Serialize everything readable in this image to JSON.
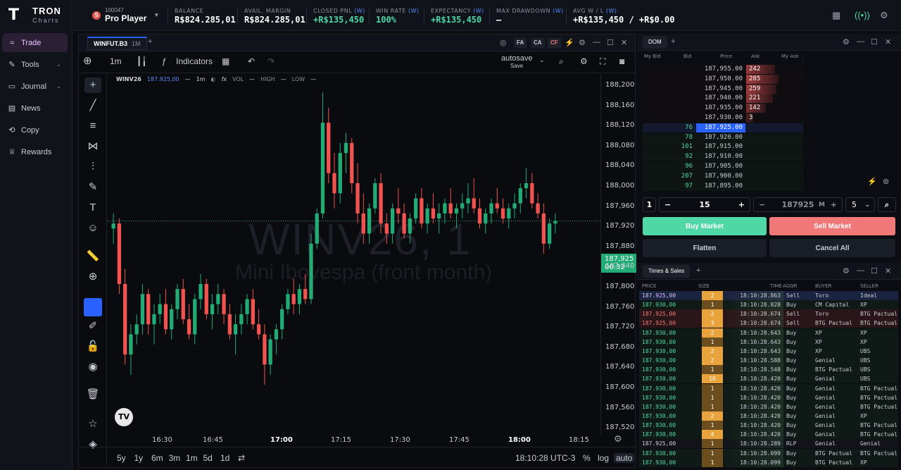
{
  "brand": {
    "name": "TRON",
    "sub": "Charts"
  },
  "nav": [
    {
      "label": "Trade",
      "icon": "chart-icon",
      "active": true
    },
    {
      "label": "Tools",
      "icon": "wrench-icon",
      "chev": true
    },
    {
      "label": "Journal",
      "icon": "book-icon",
      "chev": true
    },
    {
      "label": "News",
      "icon": "news-icon"
    },
    {
      "label": "Copy",
      "icon": "copy-icon"
    },
    {
      "label": "Rewards",
      "icon": "trophy-icon"
    }
  ],
  "account": {
    "badge": "S",
    "id": "100047",
    "name": "Pro Player"
  },
  "stats": [
    {
      "label": "BALANCE",
      "value": "R$824.285,01"
    },
    {
      "label": "AVAIL. MARGIN",
      "value": "R$824.285,01"
    },
    {
      "label": "CLOSED PNL",
      "w": "(W)",
      "value": "+R$135,450",
      "green": true
    },
    {
      "label": "WIN RATE",
      "w": "(W)",
      "value": "100%",
      "green": true
    },
    {
      "label": "EXPECTANCY",
      "w": "(W)",
      "value": "+R$135,450",
      "green": true
    },
    {
      "label": "MAX DRAWDOWN",
      "w": "(W)",
      "value": "—"
    },
    {
      "label": "AVG W / L",
      "w": "(W)",
      "value": "+R$135,450 / +R$0.00"
    }
  ],
  "chart": {
    "tab": "WINFUT.B3",
    "tab_tf": "1M",
    "buttons": [
      "FA",
      "CA",
      "CF"
    ],
    "toolbar": {
      "tf": "1m",
      "indicators": "Indicators",
      "autosave": "autosave",
      "save": "Save"
    },
    "legend": {
      "symbol": "WINV26",
      "price": "187.925,00",
      "dash": "—",
      "tf": "1m",
      "vol": "VOL",
      "high": "HIGH",
      "low": "LOW"
    },
    "watermark": {
      "title": "WINV26, 1",
      "sub": "Mini Ibovespa (front month)"
    },
    "yticks": [
      "188,200",
      "188,160",
      "188,120",
      "188,080",
      "188,040",
      "188,000",
      "187,960",
      "187,920",
      "187,880",
      "187,840",
      "187,800",
      "187,760",
      "187,720",
      "187,680",
      "187,640",
      "187,600",
      "187,560",
      "187,520"
    ],
    "ytag": {
      "price": "187,925",
      "countdown": "00:32"
    },
    "xticks": [
      {
        "t": "16:30"
      },
      {
        "t": "16:45"
      },
      {
        "t": "17:00",
        "b": true
      },
      {
        "t": "17:15"
      },
      {
        "t": "17:30"
      },
      {
        "t": "17:45"
      },
      {
        "t": "18:00",
        "b": true
      },
      {
        "t": "18:15"
      }
    ],
    "ranges": [
      "5y",
      "1y",
      "6m",
      "3m",
      "1m",
      "5d",
      "1d"
    ],
    "bottom": {
      "time": "18:10:28 UTC-3",
      "pct": "%",
      "log": "log",
      "auto": "auto"
    }
  },
  "chart_data": {
    "type": "candlestick",
    "title": "WINV26, 1",
    "ylim": [
      187520,
      188200
    ],
    "last": 187925,
    "x_start": "16:21",
    "x_end": "18:10",
    "ohlc": [
      [
        187910,
        187940,
        187880,
        187920
      ],
      [
        187920,
        187930,
        187780,
        187800
      ],
      [
        187800,
        187830,
        187640,
        187660
      ],
      [
        187660,
        187720,
        187620,
        187700
      ],
      [
        187700,
        187740,
        187680,
        187720
      ],
      [
        187720,
        187800,
        187700,
        187780
      ],
      [
        187780,
        187790,
        187700,
        187720
      ],
      [
        187720,
        187760,
        187680,
        187740
      ],
      [
        187740,
        187780,
        187720,
        187760
      ],
      [
        187760,
        187790,
        187700,
        187710
      ],
      [
        187710,
        187760,
        187690,
        187750
      ],
      [
        187750,
        187800,
        187730,
        187790
      ],
      [
        187790,
        187810,
        187720,
        187730
      ],
      [
        187730,
        187760,
        187690,
        187700
      ],
      [
        187700,
        187780,
        187680,
        187770
      ],
      [
        187770,
        187820,
        187750,
        187800
      ],
      [
        187800,
        187810,
        187730,
        187740
      ],
      [
        187740,
        187780,
        187710,
        187760
      ],
      [
        187760,
        187800,
        187740,
        187780
      ],
      [
        187780,
        187790,
        187720,
        187740
      ],
      [
        187740,
        187760,
        187690,
        187700
      ],
      [
        187700,
        187740,
        187660,
        187720
      ],
      [
        187720,
        187760,
        187700,
        187740
      ],
      [
        187740,
        187780,
        187720,
        187770
      ],
      [
        187770,
        187790,
        187710,
        187720
      ],
      [
        187720,
        187750,
        187690,
        187700
      ],
      [
        187700,
        187720,
        187600,
        187640
      ],
      [
        187640,
        187700,
        187620,
        187690
      ],
      [
        187690,
        187720,
        187660,
        187710
      ],
      [
        187710,
        187760,
        187690,
        187750
      ],
      [
        187750,
        187790,
        187740,
        187780
      ],
      [
        187780,
        187810,
        187740,
        187760
      ],
      [
        187760,
        187800,
        187740,
        187790
      ],
      [
        187790,
        187820,
        187760,
        187770
      ],
      [
        187770,
        187900,
        187760,
        187880
      ],
      [
        187880,
        187950,
        187870,
        187940
      ],
      [
        187940,
        188180,
        187930,
        188120
      ],
      [
        188120,
        188150,
        188000,
        188020
      ],
      [
        188020,
        188060,
        187950,
        187980
      ],
      [
        187980,
        188080,
        187960,
        188060
      ],
      [
        188060,
        188100,
        188020,
        188080
      ],
      [
        188080,
        188090,
        187980,
        188000
      ],
      [
        188000,
        188040,
        187920,
        187940
      ],
      [
        187940,
        187980,
        187880,
        187900
      ],
      [
        187900,
        187960,
        187880,
        187950
      ],
      [
        187950,
        188010,
        187940,
        188000
      ],
      [
        188000,
        188020,
        187900,
        187920
      ],
      [
        187920,
        187940,
        187880,
        187900
      ],
      [
        187900,
        187960,
        187880,
        187950
      ],
      [
        187950,
        187990,
        187920,
        187940
      ],
      [
        187940,
        187960,
        187890,
        187900
      ],
      [
        187900,
        187940,
        187880,
        187930
      ],
      [
        187930,
        187980,
        187920,
        187970
      ],
      [
        187970,
        187990,
        187910,
        187920
      ],
      [
        187920,
        187960,
        187900,
        187950
      ],
      [
        187950,
        187980,
        187920,
        187930
      ],
      [
        187930,
        187960,
        187900,
        187940
      ],
      [
        187940,
        187970,
        187920,
        187960
      ],
      [
        187960,
        187990,
        187930,
        187940
      ],
      [
        187940,
        187960,
        187910,
        187950
      ],
      [
        187950,
        187980,
        187930,
        187960
      ],
      [
        187960,
        188000,
        187940,
        187970
      ],
      [
        187970,
        188010,
        187940,
        187950
      ],
      [
        187950,
        187970,
        187910,
        187920
      ],
      [
        187920,
        187950,
        187900,
        187940
      ],
      [
        187940,
        187970,
        187920,
        187960
      ],
      [
        187960,
        187990,
        187940,
        187950
      ],
      [
        187950,
        187970,
        187920,
        187930
      ],
      [
        187930,
        187960,
        187910,
        187950
      ],
      [
        187950,
        187980,
        187930,
        187960
      ],
      [
        187960,
        188000,
        187940,
        187990
      ],
      [
        187990,
        188030,
        187970,
        188000
      ],
      [
        188000,
        188020,
        187950,
        187960
      ],
      [
        187960,
        187980,
        187930,
        187940
      ],
      [
        187940,
        187960,
        187860,
        187880
      ],
      [
        187880,
        187930,
        187870,
        187920
      ],
      [
        187920,
        187940,
        187900,
        187925
      ]
    ]
  },
  "dom": {
    "tab": "DOM",
    "headers": [
      "My Bid",
      "Bid",
      "Price",
      "Ask",
      "My Ask"
    ],
    "rows": [
      {
        "price": "187,955.00",
        "ask": "242"
      },
      {
        "price": "187,950.00",
        "ask": "285"
      },
      {
        "price": "187,945.00",
        "ask": "259"
      },
      {
        "price": "187,940.00",
        "ask": "221"
      },
      {
        "price": "187,935.00",
        "ask": "142"
      },
      {
        "price": "187,930.00",
        "ask": "3"
      },
      {
        "price": "187,925.00",
        "bid": "76",
        "current": true
      },
      {
        "price": "187,920.00",
        "bid": "78"
      },
      {
        "price": "187,915.00",
        "bid": "101"
      },
      {
        "price": "187,910.00",
        "bid": "92"
      },
      {
        "price": "187,905.00",
        "bid": "96"
      },
      {
        "price": "187,900.00",
        "bid": "207"
      },
      {
        "price": "187,895.00",
        "bid": "97"
      }
    ],
    "qty_step": "1",
    "qty": "15",
    "limit_price": "187925",
    "limit_type": "M",
    "offset": "5",
    "buy": "Buy Market",
    "sell": "Sell Market",
    "flatten": "Flatten",
    "cancel": "Cancel All",
    "colors": {
      "buy": "#4fd8a6",
      "sell": "#f07878"
    }
  },
  "ts": {
    "tab": "Times & Sales",
    "headers": [
      "PRICE",
      "SIZE",
      "TIME",
      "AGGR",
      "BUYER",
      "SELLER"
    ],
    "rows": [
      {
        "price": "187.925,00",
        "size": "2",
        "time": "18:10:28.863",
        "aggr": "Sell",
        "buyer": "Toro",
        "seller": "Ideal",
        "hl": true
      },
      {
        "price": "187.930,00",
        "size": "1",
        "time": "18:10:28.828",
        "aggr": "Buy",
        "buyer": "CM Capital",
        "seller": "XP"
      },
      {
        "price": "187.925,00",
        "size": "2",
        "time": "18:10:28.674",
        "aggr": "Sell",
        "buyer": "Toro",
        "seller": "BTG Pactual"
      },
      {
        "price": "187.925,00",
        "size": "3",
        "time": "18:10:28.674",
        "aggr": "Sell",
        "buyer": "BTG Pactual",
        "seller": "BTG Pactual"
      },
      {
        "price": "187.930,00",
        "size": "2",
        "time": "18:10:28.643",
        "aggr": "Buy",
        "buyer": "XP",
        "seller": "XP"
      },
      {
        "price": "187.930,00",
        "size": "1",
        "time": "18:10:28.643",
        "aggr": "Buy",
        "buyer": "XP",
        "seller": "XP"
      },
      {
        "price": "187.930,00",
        "size": "2",
        "time": "18:10:28.643",
        "aggr": "Buy",
        "buyer": "XP",
        "seller": "UBS"
      },
      {
        "price": "187.930,00",
        "size": "2",
        "time": "18:10:28.588",
        "aggr": "Buy",
        "buyer": "Genial",
        "seller": "UBS"
      },
      {
        "price": "187.930,00",
        "size": "1",
        "time": "18:10:28.548",
        "aggr": "Buy",
        "buyer": "BTG Pactual",
        "seller": "UBS"
      },
      {
        "price": "187.930,00",
        "size": "10",
        "time": "18:10:28.420",
        "aggr": "Buy",
        "buyer": "Genial",
        "seller": "UBS"
      },
      {
        "price": "187.930,00",
        "size": "1",
        "time": "18:10:28.420",
        "aggr": "Buy",
        "buyer": "Genial",
        "seller": "BTG Pactual"
      },
      {
        "price": "187.930,00",
        "size": "1",
        "time": "18:10:28.420",
        "aggr": "Buy",
        "buyer": "Genial",
        "seller": "BTG Pactual"
      },
      {
        "price": "187.930,00",
        "size": "1",
        "time": "18:10:28.420",
        "aggr": "Buy",
        "buyer": "Genial",
        "seller": "BTG Pactual"
      },
      {
        "price": "187.930,00",
        "size": "2",
        "time": "18:10:28.420",
        "aggr": "Buy",
        "buyer": "Genial",
        "seller": "XP"
      },
      {
        "price": "187.930,00",
        "size": "1",
        "time": "18:10:28.420",
        "aggr": "Buy",
        "buyer": "Genial",
        "seller": "BTG Pactual"
      },
      {
        "price": "187.930,00",
        "size": "4",
        "time": "18:10:28.420",
        "aggr": "Buy",
        "buyer": "Genial",
        "seller": "BTG Pactual"
      },
      {
        "price": "187.925,00",
        "size": "1",
        "time": "18:10:28.289",
        "aggr": "RLP",
        "buyer": "Genial",
        "seller": "Genial"
      },
      {
        "price": "187.930,00",
        "size": "1",
        "time": "18:10:28.099",
        "aggr": "Buy",
        "buyer": "BTG Pactual",
        "seller": "BTG Pactual"
      },
      {
        "price": "187.930,00",
        "size": "1",
        "time": "18:10:28.099",
        "aggr": "Buy",
        "buyer": "BTG Pactual",
        "seller": "XP"
      }
    ]
  }
}
